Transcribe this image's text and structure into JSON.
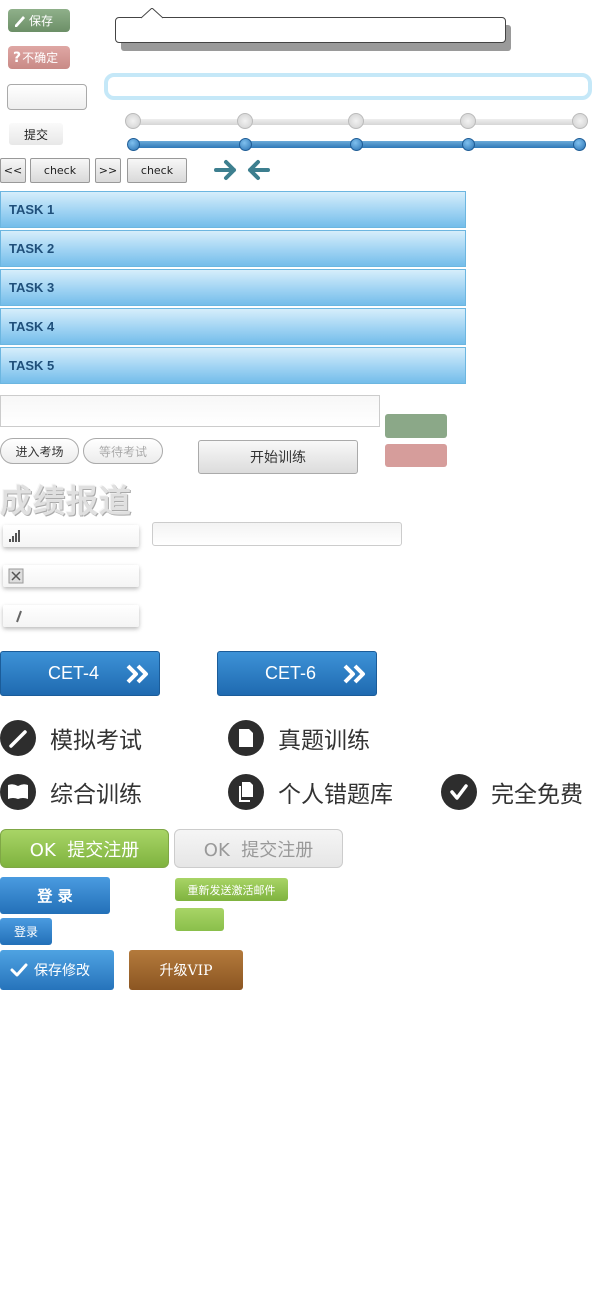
{
  "buttons": {
    "save": "保存",
    "unsure": "不确定",
    "unsure_icon": "?",
    "submit_small": "提交",
    "nav_prev": "<<",
    "nav_next": ">>",
    "check1": "check",
    "check2": "check",
    "enter_exam": "进入考场",
    "wait_exam": "等待考试",
    "start_training": "开始训练",
    "cet4": "CET-4",
    "cet6": "CET-6",
    "ok_register": "OK  提交注册",
    "ok_register_disabled": "OK  提交注册",
    "login_big": "登 录",
    "login_small": "登录",
    "resend_activation": "重新发送激活邮件",
    "save_changes": "保存修改",
    "upgrade_vip": "升级VIP"
  },
  "tasks": [
    "TASK 1",
    "TASK 2",
    "TASK 3",
    "TASK 4",
    "TASK 5"
  ],
  "report_title": "成绩报道",
  "features": [
    {
      "label": "模拟考试",
      "icon": "pencil-icon"
    },
    {
      "label": "真题训练",
      "icon": "document-icon"
    },
    {
      "label": "综合训练",
      "icon": "book-icon"
    },
    {
      "label": "个人错题库",
      "icon": "documents-icon"
    },
    {
      "label": "完全免费",
      "icon": "checkmark-icon"
    }
  ],
  "colors": {
    "green": "#7fb33f",
    "blue": "#2370b8",
    "brown": "#8c5622",
    "task_blue": "#9fd3f3"
  }
}
